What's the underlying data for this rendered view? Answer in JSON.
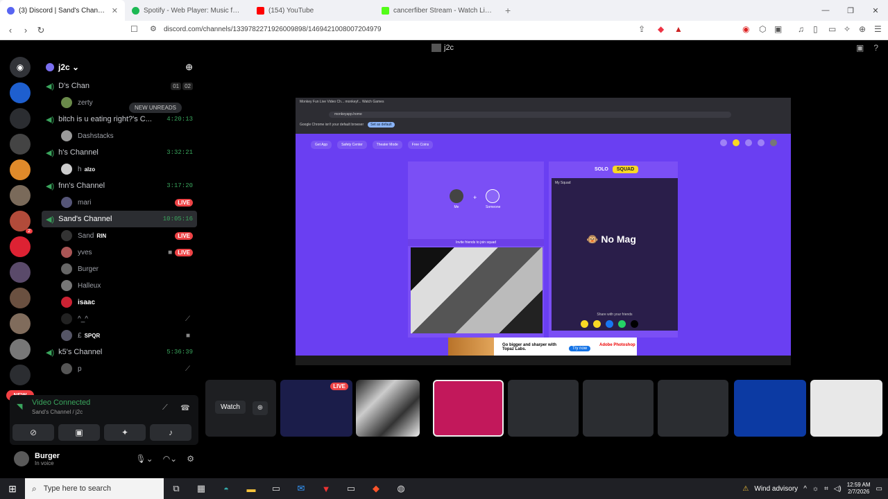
{
  "browser": {
    "tabs": [
      {
        "title": "(3) Discord | Sand's Channel | ",
        "active": true,
        "color": "#5865f2"
      },
      {
        "title": "Spotify - Web Player: Music for every",
        "active": false,
        "color": "#1db954"
      },
      {
        "title": "(154) YouTube",
        "active": false,
        "color": "#ff0000"
      },
      {
        "title": "cancerfiber Stream - Watch Live on ",
        "active": false,
        "color": "#53fc18"
      }
    ],
    "url": "discord.com/channels/1339782271926009898/1469421008007204979"
  },
  "discord": {
    "title": "j2c",
    "server_name": "j2c",
    "new_unreads": "NEW UNREADS",
    "new_label": "NEW",
    "channels": [
      {
        "name": "D's Chan",
        "time": "",
        "shortcut": [
          "01",
          "02"
        ],
        "users": [
          {
            "name": "zerty",
            "live": ""
          }
        ]
      },
      {
        "name": "bitch is u eating right?'s C...",
        "time": "4:20:13",
        "users": [
          {
            "name": "Dashstacks",
            "live": ""
          }
        ]
      },
      {
        "name": "h's Channel",
        "time": "3:32:21",
        "users": [
          {
            "name": "h",
            "tag": "alzo",
            "live": ""
          }
        ]
      },
      {
        "name": "fnn's Channel",
        "time": "3:17:20",
        "users": [
          {
            "name": "mari",
            "live": "LIVE"
          }
        ]
      },
      {
        "name": "Sand's Channel",
        "time": "10:05:16",
        "selected": true,
        "users": [
          {
            "name": "Sand",
            "tag": "RIN",
            "live": "LIVE"
          },
          {
            "name": "yves",
            "live": "LIVE",
            "cam": true
          },
          {
            "name": "Burger",
            "live": ""
          },
          {
            "name": "Halleux",
            "live": ""
          },
          {
            "name": "isaac",
            "live": ""
          },
          {
            "name": "^_^",
            "live": ""
          },
          {
            "name": "£",
            "tag": "SPQR",
            "live": ""
          }
        ]
      },
      {
        "name": "k5's Channel",
        "time": "5:36:39",
        "users": [
          {
            "name": "p",
            "live": ""
          }
        ]
      }
    ],
    "voice": {
      "status": "Video Connected",
      "sub": "Sand's Channel / j2c"
    },
    "user": {
      "name": "Burger",
      "status": "In voice"
    },
    "watch_label": "Watch",
    "tile_live": "LIVE"
  },
  "stream": {
    "tabs": "Monkey Fun Live Video Ch...   monkeyf... Watch Games",
    "url": "monkeyapp.home",
    "banner": "Google Chrome isn't your default browser",
    "banner_btn": "Set as default",
    "nav": [
      "Get App",
      "Safety Center",
      "Theater Mode",
      "Free Coins"
    ],
    "me": "Me",
    "someone": "Someone",
    "invite": "Invite friends to join squad",
    "toggle_solo": "SOLO",
    "toggle_squad": "SQUAD",
    "squad_header": "My Squad",
    "logo": "No Mag",
    "share": "Share with your friends",
    "ad_text": "Go bigger and sharper with Topaz Labs.",
    "ad_btn": "Try now",
    "ad_brand": "Adobe Photoshop"
  },
  "taskbar": {
    "search_placeholder": "Type here to search",
    "weather": "Wind advisory",
    "time": "12:59 AM",
    "date": "2/7/2026"
  }
}
